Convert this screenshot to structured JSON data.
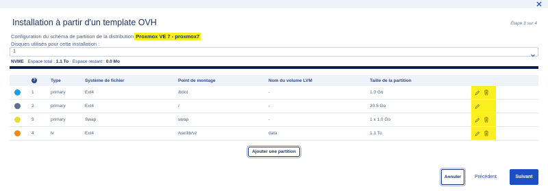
{
  "header": {
    "title": "Installation à partir d'un template OVH",
    "step": "Étape 3 sur 4",
    "close_icon": "close-icon"
  },
  "config": {
    "label": "Configuration du schéma de partition de la distribution",
    "distribution": "Proxmox VE 7 - proxmox7"
  },
  "disks": {
    "label": "Disques utilisés pour cette installation :",
    "selected": "1"
  },
  "storage": {
    "type": "NVME",
    "total_label": "Espace total :",
    "total_value": "1.1 To",
    "remaining_label": "Espace restant :",
    "remaining_value": "0.0 Mo"
  },
  "table": {
    "headers": [
      "",
      "?",
      "Type",
      "Système de fichier",
      "Point de montage",
      "Nom du volume LVM",
      "Taille de la partition",
      ""
    ],
    "rows": [
      {
        "color": "#1f9be6",
        "order": "1",
        "type": "primary",
        "fs": "Ext4",
        "mount": "/boot",
        "lvm": "-",
        "size": "1.0 Go",
        "deletable": true
      },
      {
        "color": "#5f7190",
        "order": "2",
        "type": "primary",
        "fs": "Ext4",
        "mount": "/",
        "lvm": "-",
        "size": "20.5 Go",
        "deletable": false
      },
      {
        "color": "#e4dd3a",
        "order": "3",
        "type": "primary",
        "fs": "Swap",
        "mount": "swap",
        "lvm": "-",
        "size": "1 x 1.0 Go",
        "deletable": true
      },
      {
        "color": "#f08a14",
        "order": "4",
        "type": "lv",
        "fs": "Ext4",
        "mount": "/var/lib/vz",
        "lvm": "data",
        "size": "1.1 To",
        "deletable": true
      }
    ]
  },
  "add_partition_label": "Ajouter une partition",
  "footer": {
    "cancel": "Annuler",
    "previous": "Précédent",
    "next": "Suivant"
  },
  "colors": {
    "accent": "#1b4fc3",
    "highlight": "#fbf01f",
    "progress": "#0d1f4d"
  }
}
